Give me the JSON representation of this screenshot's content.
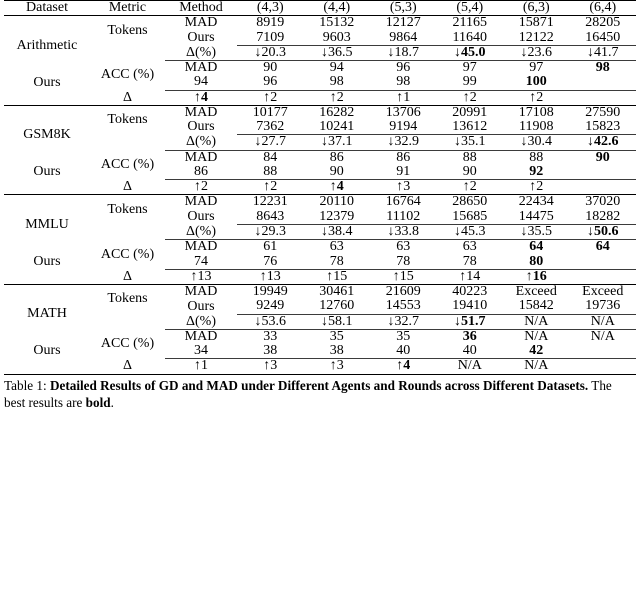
{
  "table": {
    "columns": {
      "dataset": "Dataset",
      "metric": "Metric",
      "method": "Method",
      "rounds": [
        "(4,3)",
        "(4,4)",
        "(5,3)",
        "(5,4)",
        "(6,3)",
        "(6,4)"
      ]
    },
    "labels": {
      "mad": "MAD",
      "ours": "Ours",
      "tokens": "Tokens",
      "acc": "ACC (%)",
      "delta_pct": "Δ(%)",
      "delta": "Δ",
      "down_arrow": "↓",
      "up_arrow": "↑"
    },
    "groups": [
      {
        "dataset": "Arithmetic",
        "tokens": {
          "metric": "Tokens",
          "mad": [
            {
              "v": "8919",
              "bold": false
            },
            {
              "v": "15132",
              "bold": false
            },
            {
              "v": "12127",
              "bold": false
            },
            {
              "v": "21165",
              "bold": false
            },
            {
              "v": "15871",
              "bold": false
            },
            {
              "v": "28205",
              "bold": false
            }
          ],
          "ours": [
            {
              "v": "7109",
              "bold": false
            },
            {
              "v": "9603",
              "bold": false
            },
            {
              "v": "9864",
              "bold": false
            },
            {
              "v": "11640",
              "bold": false
            },
            {
              "v": "12122",
              "bold": false
            },
            {
              "v": "16450",
              "bold": false
            }
          ],
          "delta_label": "Δ(%)",
          "delta": [
            {
              "arrow": "↓",
              "v": "20.3",
              "bold": false
            },
            {
              "arrow": "↓",
              "v": "36.5",
              "bold": false
            },
            {
              "arrow": "↓",
              "v": "18.7",
              "bold": false
            },
            {
              "arrow": "↓",
              "v": "45.0",
              "bold": true
            },
            {
              "arrow": "↓",
              "v": "23.6",
              "bold": false
            },
            {
              "arrow": "↓",
              "v": "41.7",
              "bold": false
            }
          ]
        },
        "acc": {
          "metric": "ACC (%)",
          "mad": [
            {
              "v": "90",
              "bold": false
            },
            {
              "v": "94",
              "bold": false
            },
            {
              "v": "96",
              "bold": false
            },
            {
              "v": "97",
              "bold": false
            },
            {
              "v": "97",
              "bold": false
            },
            {
              "v": "98",
              "bold": true
            }
          ],
          "ours": [
            {
              "v": "94",
              "bold": false
            },
            {
              "v": "96",
              "bold": false
            },
            {
              "v": "98",
              "bold": false
            },
            {
              "v": "98",
              "bold": false
            },
            {
              "v": "99",
              "bold": false
            },
            {
              "v": "100",
              "bold": true
            }
          ],
          "delta_label": "Δ",
          "delta": [
            {
              "arrow": "↑",
              "v": "4",
              "bold": true
            },
            {
              "arrow": "↑",
              "v": "2",
              "bold": false
            },
            {
              "arrow": "↑",
              "v": "2",
              "bold": false
            },
            {
              "arrow": "↑",
              "v": "1",
              "bold": false
            },
            {
              "arrow": "↑",
              "v": "2",
              "bold": false
            },
            {
              "arrow": "↑",
              "v": "2",
              "bold": false
            }
          ]
        }
      },
      {
        "dataset": "GSM8K",
        "tokens": {
          "metric": "Tokens",
          "mad": [
            {
              "v": "10177",
              "bold": false
            },
            {
              "v": "16282",
              "bold": false
            },
            {
              "v": "13706",
              "bold": false
            },
            {
              "v": "20991",
              "bold": false
            },
            {
              "v": "17108",
              "bold": false
            },
            {
              "v": "27590",
              "bold": false
            }
          ],
          "ours": [
            {
              "v": "7362",
              "bold": false
            },
            {
              "v": "10241",
              "bold": false
            },
            {
              "v": "9194",
              "bold": false
            },
            {
              "v": "13612",
              "bold": false
            },
            {
              "v": "11908",
              "bold": false
            },
            {
              "v": "15823",
              "bold": false
            }
          ],
          "delta_label": "Δ(%)",
          "delta": [
            {
              "arrow": "↓",
              "v": "27.7",
              "bold": false
            },
            {
              "arrow": "↓",
              "v": "37.1",
              "bold": false
            },
            {
              "arrow": "↓",
              "v": "32.9",
              "bold": false
            },
            {
              "arrow": "↓",
              "v": "35.1",
              "bold": false
            },
            {
              "arrow": "↓",
              "v": "30.4",
              "bold": false
            },
            {
              "arrow": "↓",
              "v": "42.6",
              "bold": true
            }
          ]
        },
        "acc": {
          "metric": "ACC (%)",
          "mad": [
            {
              "v": "84",
              "bold": false
            },
            {
              "v": "86",
              "bold": false
            },
            {
              "v": "86",
              "bold": false
            },
            {
              "v": "88",
              "bold": false
            },
            {
              "v": "88",
              "bold": false
            },
            {
              "v": "90",
              "bold": true
            }
          ],
          "ours": [
            {
              "v": "86",
              "bold": false
            },
            {
              "v": "88",
              "bold": false
            },
            {
              "v": "90",
              "bold": false
            },
            {
              "v": "91",
              "bold": false
            },
            {
              "v": "90",
              "bold": false
            },
            {
              "v": "92",
              "bold": true
            }
          ],
          "delta_label": "Δ",
          "delta": [
            {
              "arrow": "↑",
              "v": "2",
              "bold": false
            },
            {
              "arrow": "↑",
              "v": "2",
              "bold": false
            },
            {
              "arrow": "↑",
              "v": "4",
              "bold": true
            },
            {
              "arrow": "↑",
              "v": "3",
              "bold": false
            },
            {
              "arrow": "↑",
              "v": "2",
              "bold": false
            },
            {
              "arrow": "↑",
              "v": "2",
              "bold": false
            }
          ]
        }
      },
      {
        "dataset": "MMLU",
        "tokens": {
          "metric": "Tokens",
          "mad": [
            {
              "v": "12231",
              "bold": false
            },
            {
              "v": "20110",
              "bold": false
            },
            {
              "v": "16764",
              "bold": false
            },
            {
              "v": "28650",
              "bold": false
            },
            {
              "v": "22434",
              "bold": false
            },
            {
              "v": "37020",
              "bold": false
            }
          ],
          "ours": [
            {
              "v": "8643",
              "bold": false
            },
            {
              "v": "12379",
              "bold": false
            },
            {
              "v": "11102",
              "bold": false
            },
            {
              "v": "15685",
              "bold": false
            },
            {
              "v": "14475",
              "bold": false
            },
            {
              "v": "18282",
              "bold": false
            }
          ],
          "delta_label": "Δ(%)",
          "delta": [
            {
              "arrow": "↓",
              "v": "29.3",
              "bold": false
            },
            {
              "arrow": "↓",
              "v": "38.4",
              "bold": false
            },
            {
              "arrow": "↓",
              "v": "33.8",
              "bold": false
            },
            {
              "arrow": "↓",
              "v": "45.3",
              "bold": false
            },
            {
              "arrow": "↓",
              "v": "35.5",
              "bold": false
            },
            {
              "arrow": "↓",
              "v": "50.6",
              "bold": true
            }
          ]
        },
        "acc": {
          "metric": "ACC (%)",
          "mad": [
            {
              "v": "61",
              "bold": false
            },
            {
              "v": "63",
              "bold": false
            },
            {
              "v": "63",
              "bold": false
            },
            {
              "v": "63",
              "bold": false
            },
            {
              "v": "64",
              "bold": true
            },
            {
              "v": "64",
              "bold": true
            }
          ],
          "ours": [
            {
              "v": "74",
              "bold": false
            },
            {
              "v": "76",
              "bold": false
            },
            {
              "v": "78",
              "bold": false
            },
            {
              "v": "78",
              "bold": false
            },
            {
              "v": "78",
              "bold": false
            },
            {
              "v": "80",
              "bold": true
            }
          ],
          "delta_label": "Δ",
          "delta": [
            {
              "arrow": "↑",
              "v": "13",
              "bold": false
            },
            {
              "arrow": "↑",
              "v": "13",
              "bold": false
            },
            {
              "arrow": "↑",
              "v": "15",
              "bold": false
            },
            {
              "arrow": "↑",
              "v": "15",
              "bold": false
            },
            {
              "arrow": "↑",
              "v": "14",
              "bold": false
            },
            {
              "arrow": "↑",
              "v": "16",
              "bold": true
            }
          ]
        }
      },
      {
        "dataset": "MATH",
        "tokens": {
          "metric": "Tokens",
          "mad": [
            {
              "v": "19949",
              "bold": false
            },
            {
              "v": "30461",
              "bold": false
            },
            {
              "v": "21609",
              "bold": false
            },
            {
              "v": "40223",
              "bold": false
            },
            {
              "v": "Exceed",
              "bold": false
            },
            {
              "v": "Exceed",
              "bold": false
            }
          ],
          "ours": [
            {
              "v": "9249",
              "bold": false
            },
            {
              "v": "12760",
              "bold": false
            },
            {
              "v": "14553",
              "bold": false
            },
            {
              "v": "19410",
              "bold": false
            },
            {
              "v": "15842",
              "bold": false
            },
            {
              "v": "19736",
              "bold": false
            }
          ],
          "delta_label": "Δ(%)",
          "delta": [
            {
              "arrow": "↓",
              "v": "53.6",
              "bold": false
            },
            {
              "arrow": "↓",
              "v": "58.1",
              "bold": false
            },
            {
              "arrow": "↓",
              "v": "32.7",
              "bold": false
            },
            {
              "arrow": "↓",
              "v": "51.7",
              "bold": true
            },
            {
              "arrow": "",
              "v": "N/A",
              "bold": false
            },
            {
              "arrow": "",
              "v": "N/A",
              "bold": false
            }
          ]
        },
        "acc": {
          "metric": "ACC (%)",
          "mad": [
            {
              "v": "33",
              "bold": false
            },
            {
              "v": "35",
              "bold": false
            },
            {
              "v": "35",
              "bold": false
            },
            {
              "v": "36",
              "bold": true
            },
            {
              "v": "N/A",
              "bold": false
            },
            {
              "v": "N/A",
              "bold": false
            }
          ],
          "ours": [
            {
              "v": "34",
              "bold": false
            },
            {
              "v": "38",
              "bold": false
            },
            {
              "v": "38",
              "bold": false
            },
            {
              "v": "40",
              "bold": false
            },
            {
              "v": "40",
              "bold": false
            },
            {
              "v": "42",
              "bold": true
            }
          ],
          "delta_label": "Δ",
          "delta": [
            {
              "arrow": "↑",
              "v": "1",
              "bold": false
            },
            {
              "arrow": "↑",
              "v": "3",
              "bold": false
            },
            {
              "arrow": "↑",
              "v": "3",
              "bold": false
            },
            {
              "arrow": "↑",
              "v": "4",
              "bold": true
            },
            {
              "arrow": "",
              "v": "N/A",
              "bold": false
            },
            {
              "arrow": "",
              "v": "N/A",
              "bold": false
            }
          ]
        }
      }
    ]
  },
  "caption": {
    "label": "Table 1: ",
    "title": "Detailed Results of GD and MAD under Different Agents and Rounds across Different Datasets.",
    "note_prefix": " The best results are ",
    "note_bold": "bold",
    "note_suffix": "."
  }
}
